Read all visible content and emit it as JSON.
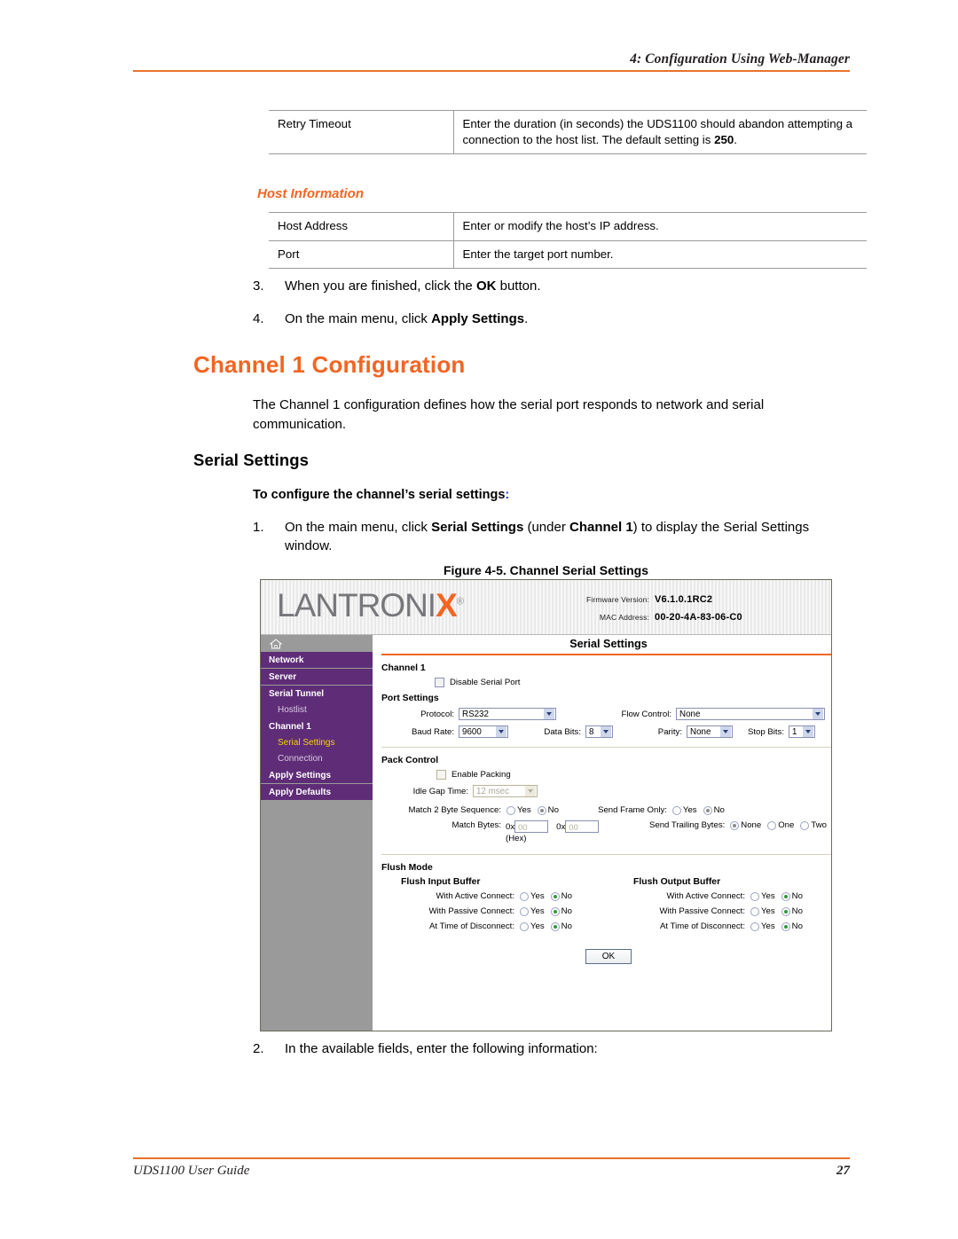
{
  "page": {
    "header_title": "4: Configuration Using Web-Manager",
    "footer_left": "UDS1100 User Guide",
    "footer_page_number": "27",
    "accent_orange": "#e8722a",
    "heading_orange": "#f26522"
  },
  "tables": {
    "retry": {
      "rows": [
        {
          "term": "Retry Timeout",
          "desc_before": "Enter the duration (in seconds) the UDS1100 should abandon attempting a connection to the host list. The default setting is ",
          "desc_bold": "250",
          "desc_after": "."
        }
      ]
    },
    "host_information_heading": "Host Information",
    "host": {
      "rows": [
        {
          "term": "Host Address",
          "desc": "Enter or modify the host’s IP address."
        },
        {
          "term": "Port",
          "desc": "Enter the target port number."
        }
      ]
    }
  },
  "steps": {
    "step3": {
      "number": "3.",
      "before": "When you are finished, click the ",
      "bold": "OK",
      "after": " button."
    },
    "step4": {
      "number": "4.",
      "before": "On the main menu, click ",
      "bold": "Apply Settings",
      "after": "."
    },
    "step1": {
      "number": "1.",
      "p1": "On the main menu, click ",
      "b1": "Serial Settings",
      "p2": " (under ",
      "b2": "Channel 1",
      "p3": ") to display the Serial Settings window."
    },
    "step2": {
      "number": "2.",
      "text": "In the available fields, enter the following information:"
    }
  },
  "headings": {
    "h1": "Channel 1 Configuration",
    "body_para": "The Channel 1 configuration defines how the serial port responds to network and serial communication.",
    "h2": "Serial Settings",
    "h3": "To configure the channel’s serial settings",
    "h3_colon": ":"
  },
  "figure": {
    "caption": "Figure 4-5. Channel Serial Settings",
    "banner": {
      "logo_text_1": "LANTRONI",
      "logo_x": "X",
      "logo_reg": "®",
      "firmware_label": "Firmware Version:",
      "firmware_value": "V6.1.0.1RC2",
      "mac_label": "MAC Address:",
      "mac_value": "00-20-4A-83-06-C0"
    },
    "nav": {
      "home_icon": "home-icon",
      "items": [
        {
          "label": "Network",
          "type": "item",
          "active": false
        },
        {
          "label": "Server",
          "type": "item",
          "active": false
        },
        {
          "label": "Serial Tunnel",
          "type": "group",
          "active": false
        },
        {
          "label": "Hostlist",
          "type": "sub",
          "active": false
        },
        {
          "label": "Channel 1",
          "type": "group",
          "active": false
        },
        {
          "label": "Serial Settings",
          "type": "sub",
          "active": true
        },
        {
          "label": "Connection",
          "type": "sub",
          "active": false
        },
        {
          "label": "Apply Settings",
          "type": "item",
          "active": false
        },
        {
          "label": "Apply Defaults",
          "type": "item",
          "active": false
        }
      ]
    },
    "panel": {
      "title": "Serial Settings",
      "channel_heading": "Channel 1",
      "disable_serial_port": {
        "label": "Disable Serial Port",
        "checked": false
      },
      "port_settings": {
        "title": "Port Settings",
        "protocol": {
          "label": "Protocol:",
          "value": "RS232"
        },
        "flow_control": {
          "label": "Flow Control:",
          "value": "None"
        },
        "baud_rate": {
          "label": "Baud Rate:",
          "value": "9600"
        },
        "data_bits": {
          "label": "Data Bits:",
          "value": "8"
        },
        "parity": {
          "label": "Parity:",
          "value": "None"
        },
        "stop_bits": {
          "label": "Stop Bits:",
          "value": "1"
        }
      },
      "pack_control": {
        "title": "Pack Control",
        "enable_packing": {
          "label": "Enable Packing",
          "checked": false
        },
        "idle_gap_time": {
          "label": "Idle Gap Time:",
          "value": "12 msec",
          "disabled": true
        },
        "match_2_byte_sequence": {
          "label": "Match 2 Byte Sequence:",
          "yes": "Yes",
          "no": "No",
          "selected": "No"
        },
        "send_frame_only": {
          "label": "Send Frame Only:",
          "yes": "Yes",
          "no": "No",
          "selected": "No"
        },
        "match_bytes": {
          "label": "Match Bytes:",
          "hex_note": "(Hex)",
          "prefix": "0x",
          "byte1": "00",
          "byte2": "00"
        },
        "send_trailing_bytes": {
          "label": "Send Trailing Bytes:",
          "options": [
            "None",
            "One",
            "Two"
          ],
          "selected": "None"
        }
      },
      "flush_mode": {
        "title": "Flush Mode",
        "input_buffer": {
          "title": "Flush Input Buffer",
          "rows": [
            {
              "label": "With Active Connect:",
              "yes": "Yes",
              "no": "No",
              "selected": "No"
            },
            {
              "label": "With Passive Connect:",
              "yes": "Yes",
              "no": "No",
              "selected": "No"
            },
            {
              "label": "At Time of Disconnect:",
              "yes": "Yes",
              "no": "No",
              "selected": "No"
            }
          ]
        },
        "output_buffer": {
          "title": "Flush Output Buffer",
          "rows": [
            {
              "label": "With Active Connect:",
              "yes": "Yes",
              "no": "No",
              "selected": "No"
            },
            {
              "label": "With Passive Connect:",
              "yes": "Yes",
              "no": "No",
              "selected": "No"
            },
            {
              "label": "At Time of Disconnect:",
              "yes": "Yes",
              "no": "No",
              "selected": "No"
            }
          ]
        },
        "ok_button": "OK"
      }
    }
  }
}
